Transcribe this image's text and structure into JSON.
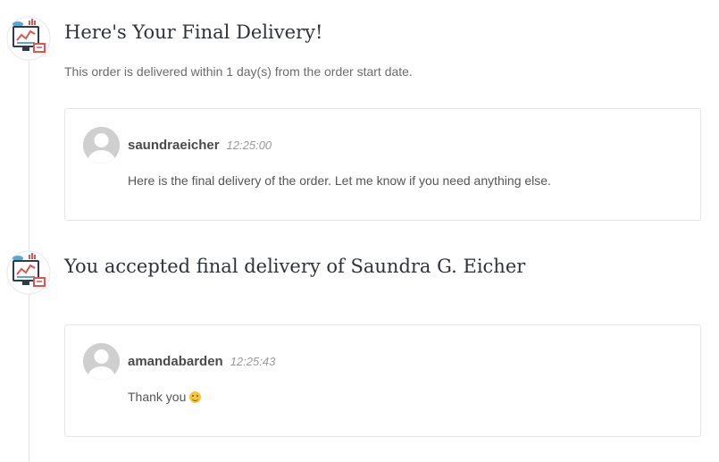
{
  "events": [
    {
      "icon": "delivery-dashboard-icon",
      "title": "Here's Your Final Delivery!",
      "subtitle": "This order is delivered within 1 day(s) from the order start date.",
      "message": {
        "avatar": "default-avatar",
        "username": "saundraeicher",
        "time": "12:25:00",
        "text": "Here is the final delivery of the order. Let me know if you need anything else."
      }
    },
    {
      "icon": "delivery-dashboard-icon",
      "title": "You accepted final delivery of Saundra G. Eicher",
      "message": {
        "avatar": "default-avatar",
        "username": "amandabarden",
        "time": "12:25:43",
        "text": "Thank you",
        "emoji": "smile-emoji"
      }
    }
  ],
  "colors": {
    "accent_blue": "#5aa7d6",
    "accent_red": "#e0534f",
    "avatar_gray": "#cfcfcf",
    "border": "#e5e5e5"
  }
}
